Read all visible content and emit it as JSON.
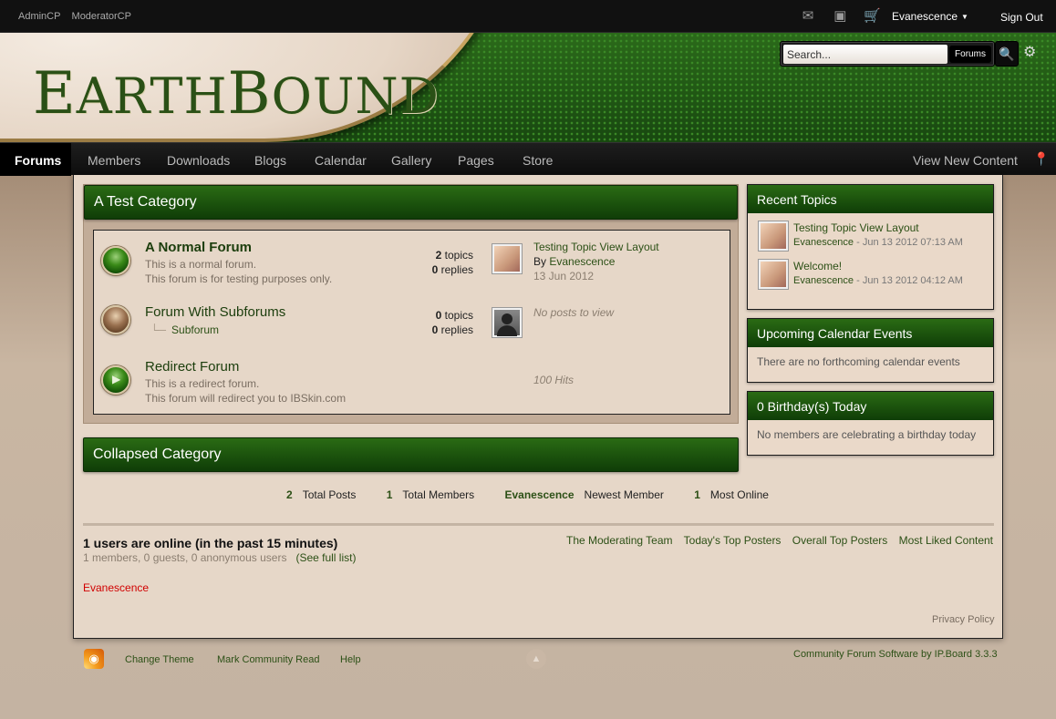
{
  "userbar": {
    "admin_links": [
      "AdminCP",
      "ModeratorCP"
    ],
    "username": "Evanescence",
    "sign_out": "Sign Out"
  },
  "branding": {
    "logo_first": "E",
    "logo_mid": "ARTH",
    "logo_b": "B",
    "logo_end": "OUND",
    "search_placeholder": "Search...",
    "search_scope": "Forums"
  },
  "nav": {
    "items": [
      "Forums",
      "Members",
      "Downloads",
      "Blogs",
      "Calendar",
      "Gallery",
      "Pages",
      "Store"
    ],
    "view_new_content": "View New Content"
  },
  "categories": [
    {
      "title": "A Test Category",
      "forums": [
        {
          "title": "A Normal Forum",
          "desc1": "This is a normal forum.",
          "desc2": "This forum is for testing purposes only.",
          "topics": "2",
          "topics_label": "topics",
          "replies": "0",
          "replies_label": "replies",
          "last_topic": "Testing Topic View Layout",
          "last_by_prefix": "By",
          "last_by": "Evanescence",
          "last_date": "13 Jun 2012"
        },
        {
          "title": "Forum With Subforums",
          "subforum": "Subforum",
          "topics": "0",
          "topics_label": "topics",
          "replies": "0",
          "replies_label": "replies",
          "no_posts": "No posts to view"
        },
        {
          "title": "Redirect Forum",
          "desc1": "This is a redirect forum.",
          "desc2": "This forum will redirect you to IBSkin.com",
          "hits": "100 Hits"
        }
      ]
    },
    {
      "title": "Collapsed Category"
    }
  ],
  "sidebar": {
    "recent_topics": {
      "title": "Recent Topics",
      "items": [
        {
          "title": "Testing Topic View Layout",
          "author": "Evanescence",
          "date": " - Jun 13 2012 07:13 AM"
        },
        {
          "title": "Welcome!",
          "author": "Evanescence",
          "date": " - Jun 13 2012 04:12 AM"
        }
      ]
    },
    "calendar": {
      "title": "Upcoming Calendar Events",
      "text": "There are no forthcoming calendar events"
    },
    "birthdays": {
      "title": "0 Birthday(s) Today",
      "text": "No members are celebrating a birthday today"
    }
  },
  "stats": {
    "total_posts": "2",
    "total_posts_label": "Total Posts",
    "total_members": "1",
    "total_members_label": "Total Members",
    "newest_member": "Evanescence",
    "newest_member_label": "Newest Member",
    "most_online": "1",
    "most_online_label": "Most Online"
  },
  "online": {
    "title": "1 users are online (in the past 15 minutes)",
    "detail": "1 members, 0 guests, 0 anonymous users",
    "full_list": "(See full list)",
    "links": [
      "The Moderating Team",
      "Today's Top Posters",
      "Overall Top Posters",
      "Most Liked Content"
    ],
    "user": "Evanescence",
    "privacy": "Privacy Policy"
  },
  "footer": {
    "change_theme": "Change Theme",
    "mark_read": "Mark Community Read",
    "help": "Help",
    "copyright": "Community Forum Software by IP.Board 3.3.3"
  }
}
